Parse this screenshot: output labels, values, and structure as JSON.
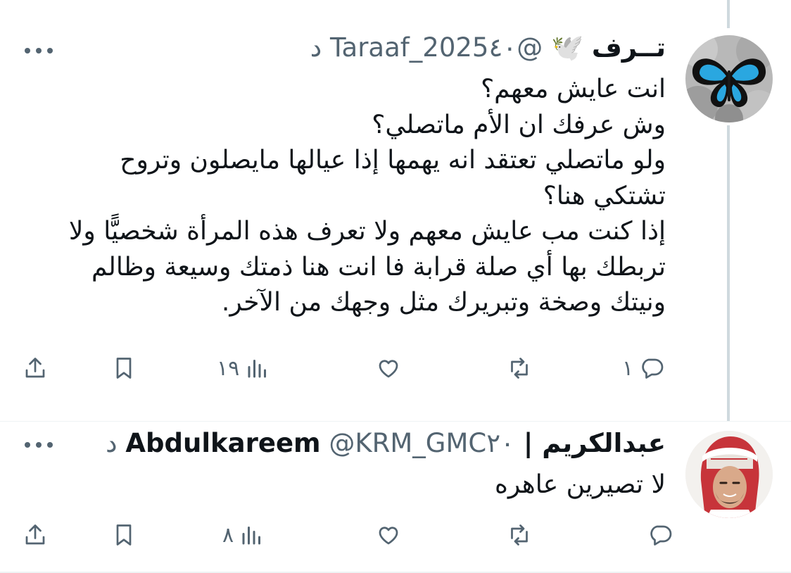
{
  "tweets": [
    {
      "display_name": "تــرف",
      "emoji": "🕊️",
      "handle": "@Taraaf_2025",
      "time": "٤٠ د",
      "text": "انت عايش معهم؟\nوش عرفك ان الأم ماتصلي؟\nولو ماتصلي تعتقد انه يهمها إذا عيالها مايصلون وتروح تشتكي هنا؟\nإذا كنت مب عايش معهم ولا تعرف هذه المرأة شخصيًّا ولا تربطك بها أي صلة قرابة فا انت هنا ذمتك وسيعة وظالم ونيتك وصخة وتبريرك مثل وجهك من الآخر.",
      "reply_count": "١",
      "retweet_count": "",
      "like_count": "",
      "view_count": "١٩"
    },
    {
      "display_name": "عبدالكريم | Abdulkareem",
      "handle": "@KRM_GMC",
      "time": "٢٠ د",
      "text": "لا تصيرين عاهره",
      "reply_count": "",
      "retweet_count": "",
      "like_count": "",
      "view_count": "٨"
    }
  ],
  "icons": {
    "reply": "reply-icon",
    "retweet": "retweet-icon",
    "like": "like-icon",
    "views": "views-icon",
    "bookmark": "bookmark-icon",
    "share": "share-icon",
    "more": "more-icon"
  },
  "colors": {
    "text": "#0f1419",
    "secondary": "#536471",
    "thread_line": "#cfd9de",
    "butterfly_blue": "#2aa7e0"
  }
}
